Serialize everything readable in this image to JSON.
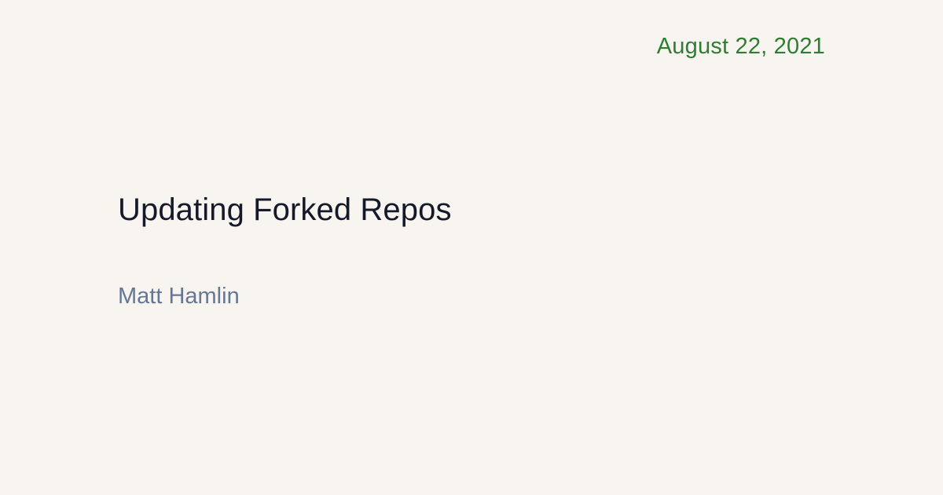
{
  "post": {
    "date": "August 22, 2021",
    "title": "Updating Forked Repos",
    "author": "Matt Hamlin"
  },
  "colors": {
    "background": "#f8f4ef",
    "date": "#2f7d32",
    "title": "#141a2a",
    "author": "#667796"
  }
}
